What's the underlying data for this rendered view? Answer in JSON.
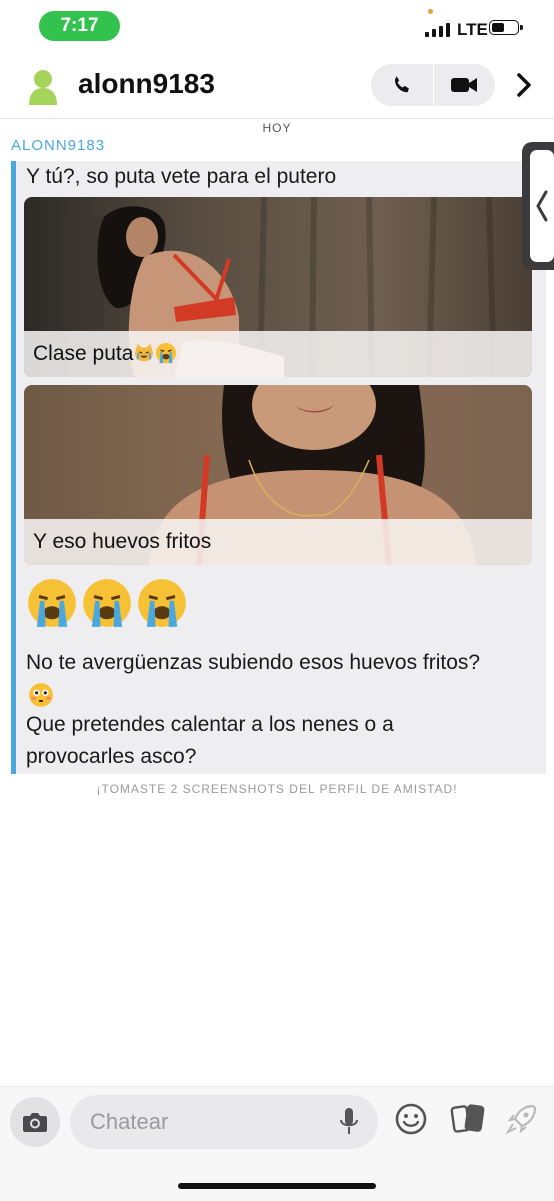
{
  "status_bar": {
    "time": "7:17",
    "network": "LTE",
    "signal_bars": 4,
    "battery_level": 0.45
  },
  "header": {
    "title": "alonn9183",
    "icons": [
      "avatar-icon",
      "phone-icon",
      "video-camera-icon",
      "chevron-right-icon"
    ]
  },
  "chat": {
    "day_label": "HOY",
    "sender": "ALONN9183",
    "messages": [
      {
        "text": "Y tú?, so puta vete para el putero"
      },
      {
        "caption": "Clase puta"
      },
      {
        "caption": "Y eso huevos fritos"
      },
      {
        "text": "No te avergüenzas subiendo esos huevos fritos?"
      },
      {
        "text_line1": "Que pretendes calentar a los nenes o a",
        "text_line2": "provocarles asco?"
      }
    ],
    "notice": "¡TOMASTE 2 SCREENSHOTS DEL PERFIL DE AMISTAD!"
  },
  "composer": {
    "placeholder": "Chatear"
  },
  "colors": {
    "accent": "#4aa8df",
    "time_pill": "#32c24d",
    "bubble_bg": "#eeeef0"
  }
}
